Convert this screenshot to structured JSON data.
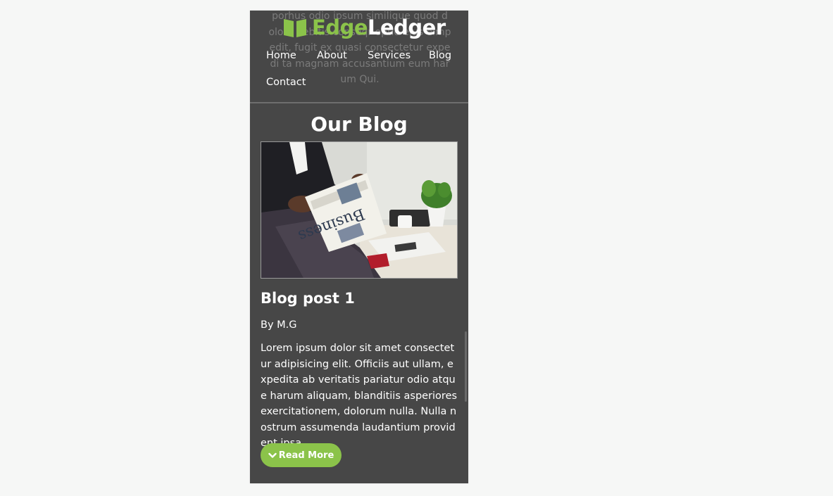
{
  "header": {
    "ghost_text": "porhus odio ipsum similique quod d olore debitis conseqr optio eius eimp edit, fugit ex quasi consectetur expedi ta magnam accusantium eum harum Qui.",
    "logo": {
      "icon": "open-book-icon",
      "part1": "Edge",
      "part2": "Ledger"
    },
    "nav": [
      "Home",
      "About",
      "Services",
      "Blog",
      "Contact"
    ]
  },
  "blog": {
    "title": "Our Blog",
    "post": {
      "image_icon": "newspaper-business-photo",
      "title": "Blog post 1",
      "author": "By M.G",
      "excerpt": "Lorem ipsum dolor sit amet consectetur adipisicing elit. Officiis aut ullam, expedita ab veritatis pariatur odio atque harum aliquam, blanditiis asperiores exercitationem, dolorum nulla. Nulla nostrum assumenda laudantium provident ipsa.",
      "read_more_icon": "chevron-down-icon",
      "read_more_label": "Read More"
    }
  },
  "colors": {
    "accent": "#8bc34a",
    "panel": "#474747",
    "page": "#f6f7f6",
    "text": "#ffffff"
  }
}
